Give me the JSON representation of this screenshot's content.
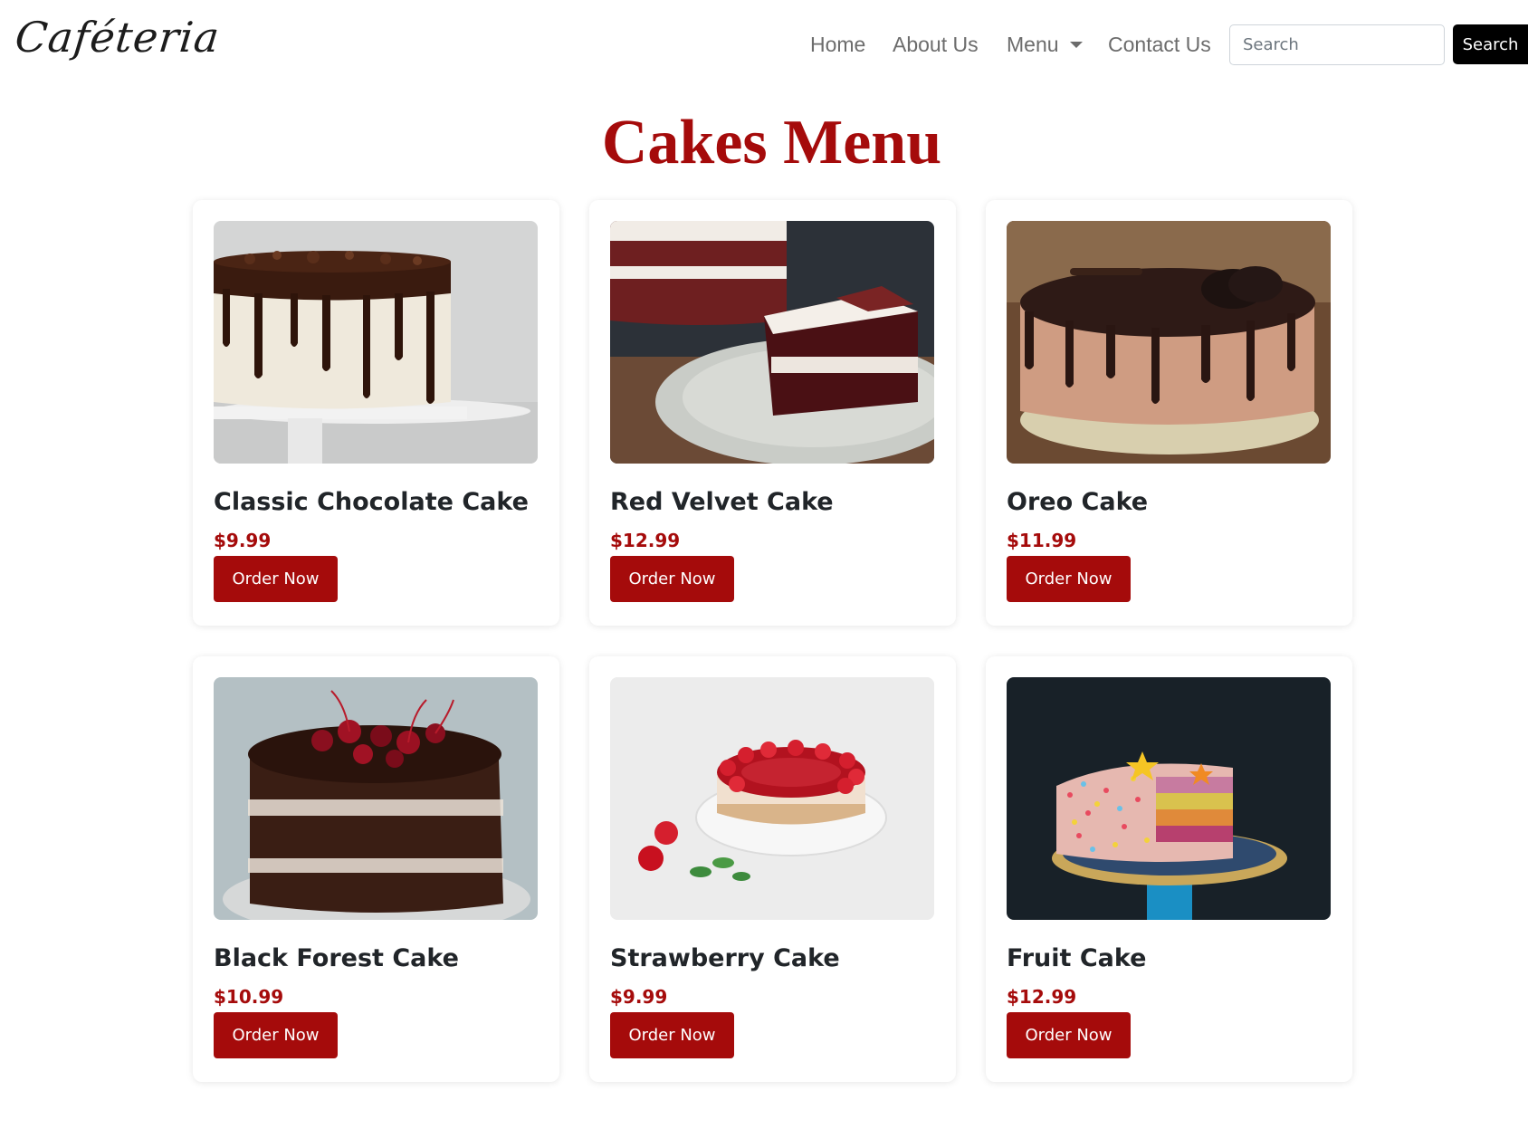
{
  "brand": {
    "name": "Caféteria"
  },
  "nav": {
    "home": "Home",
    "about": "About Us",
    "menu": "Menu",
    "contact": "Contact Us"
  },
  "search": {
    "placeholder": "Search",
    "button": "Search"
  },
  "page": {
    "title": "Cakes Menu"
  },
  "cakes": [
    {
      "name": "Classic Chocolate Cake",
      "price": "$9.99",
      "button": "Order Now",
      "image": "chocolate-drip-cake"
    },
    {
      "name": "Red Velvet Cake",
      "price": "$12.99",
      "button": "Order Now",
      "image": "red-velvet-slice"
    },
    {
      "name": "Oreo Cake",
      "price": "$11.99",
      "button": "Order Now",
      "image": "oreo-drip-cake"
    },
    {
      "name": "Black Forest Cake",
      "price": "$10.99",
      "button": "Order Now",
      "image": "black-forest-cake"
    },
    {
      "name": "Strawberry Cake",
      "price": "$9.99",
      "button": "Order Now",
      "image": "strawberry-cheesecake"
    },
    {
      "name": "Fruit Cake",
      "price": "$12.99",
      "button": "Order Now",
      "image": "sprinkle-fruit-cake"
    }
  ],
  "colors": {
    "accent": "#a50b0b",
    "search_button": "#000000",
    "nav_text": "#6c6c6c"
  }
}
